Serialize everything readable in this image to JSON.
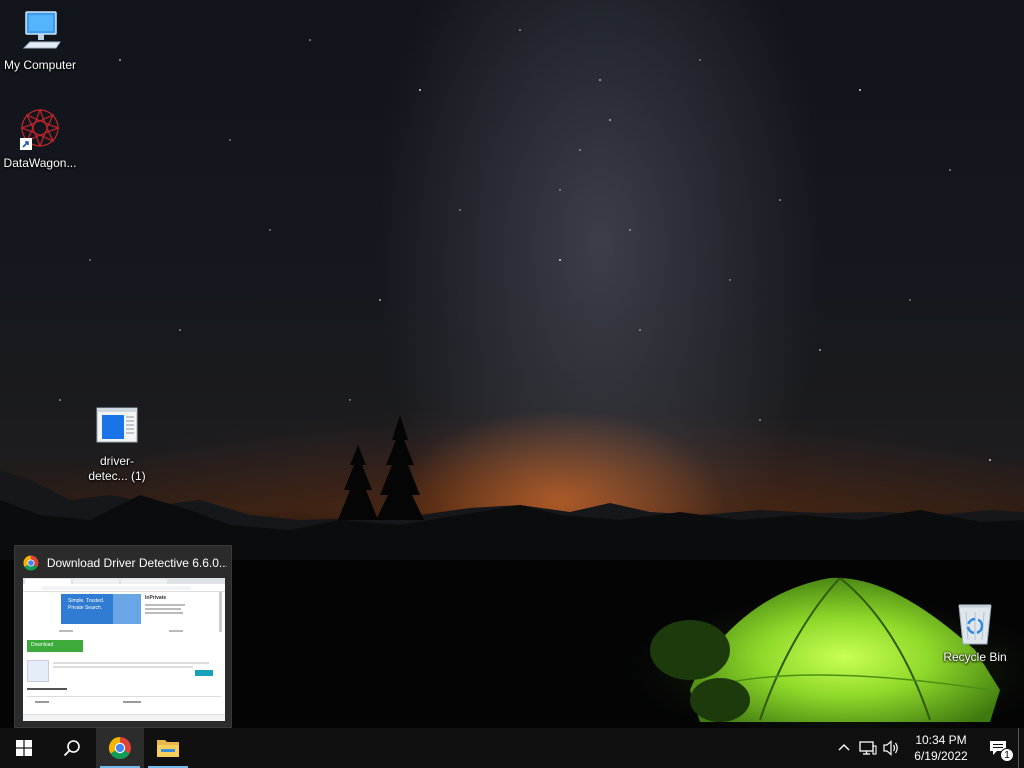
{
  "desktop": {
    "icons": [
      {
        "label": "My Computer",
        "icon": "monitor-icon"
      },
      {
        "label": "DataWagon...",
        "icon": "datawagon-icon"
      },
      {
        "label": "driver-detec... (1)",
        "icon": "installer-icon"
      },
      {
        "label": "Recycle Bin",
        "icon": "recycle-bin-icon"
      }
    ]
  },
  "preview": {
    "title": "Download Driver Detective 6.6.0...",
    "app_icon": "chrome-icon",
    "thumb": {
      "ad_line1": "Simple. Trusted.",
      "ad_line2": "Private Search.",
      "ad_side_title": "InPrivate",
      "download_label": "Download"
    }
  },
  "taskbar": {
    "start": "windows-start-icon",
    "search": "search-icon",
    "apps": [
      {
        "name": "Google Chrome",
        "icon": "chrome-icon",
        "active": true
      },
      {
        "name": "File Explorer",
        "icon": "folder-icon",
        "active": false
      }
    ],
    "tray": {
      "time": "10:34 PM",
      "date": "6/19/2022",
      "notification_count": "1"
    }
  },
  "colors": {
    "taskbar_bg": "#101010",
    "accent_underline": "#76b9ed",
    "tent_green": "#7ed321",
    "sunset_orange": "#ff7a1e"
  }
}
